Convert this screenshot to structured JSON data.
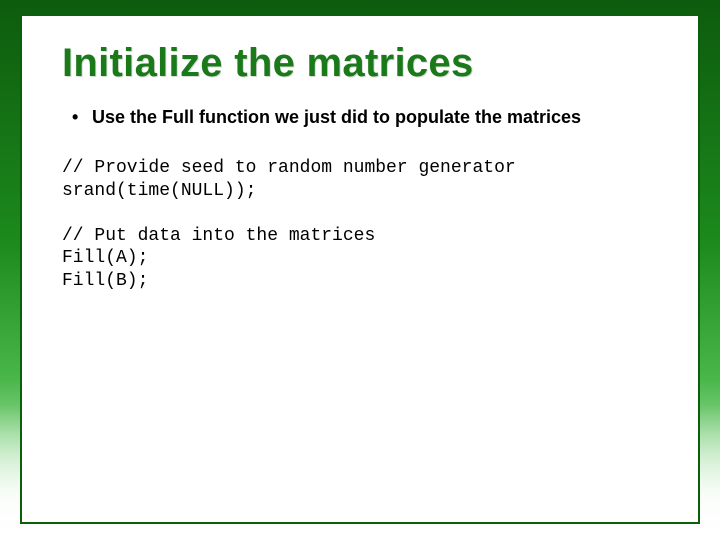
{
  "title": "Initialize the matrices",
  "bullets": [
    "Use the Full function we just did to populate the matrices"
  ],
  "code": {
    "comment1": "// Provide seed to random number generator",
    "line1": "srand(time(NULL));",
    "blank1": "",
    "comment2": "// Put data into the matrices",
    "line2": "Fill(A);",
    "line3": "Fill(B);"
  }
}
